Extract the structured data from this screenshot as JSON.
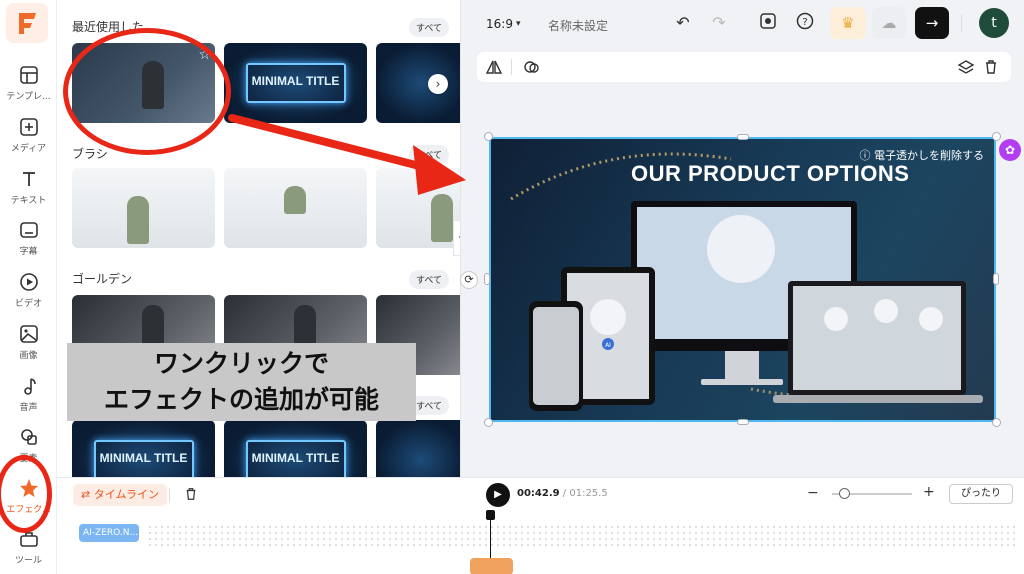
{
  "app": {
    "logo_letter": "F"
  },
  "rail": {
    "items": [
      {
        "label": "テンプレ..."
      },
      {
        "label": "メディア"
      },
      {
        "label": "テキスト"
      },
      {
        "label": "字幕"
      },
      {
        "label": "ビデオ"
      },
      {
        "label": "画像"
      },
      {
        "label": "音声"
      },
      {
        "label": "要素"
      },
      {
        "label": "エフェク..."
      },
      {
        "label": "ツール"
      }
    ]
  },
  "effects": {
    "sections": [
      {
        "title": "最近使用した",
        "all": "すべて"
      },
      {
        "title": "ブラシ",
        "all": "すべて"
      },
      {
        "title": "ゴールデン",
        "all": "すべて"
      },
      {
        "title": "",
        "all": "すべて"
      }
    ],
    "minimal_title": "MINIMAL TITLE"
  },
  "caption": {
    "line1": "ワンクリックで",
    "line2": "エフェクトの追加が可能"
  },
  "editor": {
    "ratio": "16:9",
    "project_name": "名称未設定",
    "avatar_letter": "t",
    "stage_title": "OUR PRODUCT OPTIONS",
    "watermark": "電子透かしを削除する",
    "laptop_badge": "AI"
  },
  "timeline": {
    "timeline_label": "タイムライン",
    "current": "00:42.9",
    "total": "01:25.5",
    "fit_label": "ぴったり",
    "clip_label": "AI-ZERO.N..."
  },
  "colors": {
    "accent": "#e8541e",
    "annotation": "#e82716",
    "selection": "#4fb8ee"
  }
}
